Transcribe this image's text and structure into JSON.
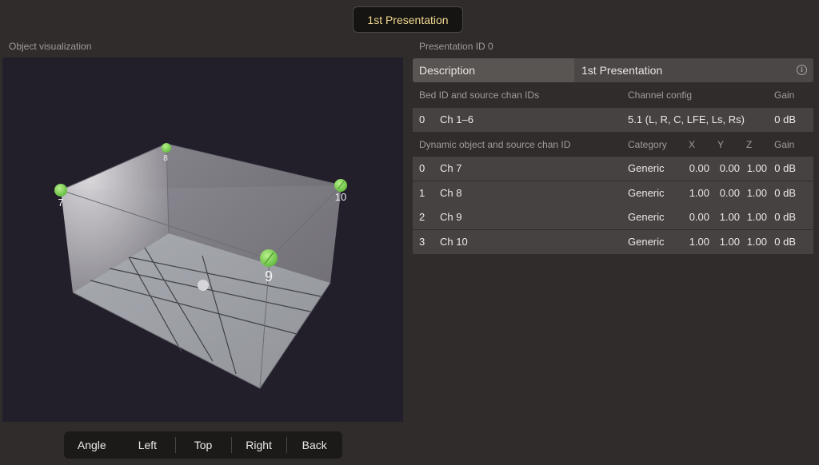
{
  "presentation_tab": "1st Presentation",
  "visualization": {
    "label": "Object visualization",
    "objects": [
      "7",
      "8",
      "9",
      "10"
    ]
  },
  "view_buttons": [
    "Angle",
    "Left",
    "Top",
    "Right",
    "Back"
  ],
  "panel": {
    "presentation_id_label": "Presentation ID 0",
    "description_label": "Description",
    "description_value": "1st Presentation",
    "bed_header": {
      "ids": "Bed ID and source chan IDs",
      "config": "Channel config",
      "gain": "Gain"
    },
    "bed_rows": [
      {
        "id": "0",
        "channels": "Ch 1–6",
        "config": "5.1 (L, R, C, LFE, Ls, Rs)",
        "gain": "0 dB"
      }
    ],
    "object_header": {
      "ids": "Dynamic object and source chan ID",
      "category": "Category",
      "x": "X",
      "y": "Y",
      "z": "Z",
      "gain": "Gain"
    },
    "object_rows": [
      {
        "id": "0",
        "channel": "Ch 7",
        "category": "Generic",
        "x": "0.00",
        "y": "0.00",
        "z": "1.00",
        "gain": "0 dB"
      },
      {
        "id": "1",
        "channel": "Ch 8",
        "category": "Generic",
        "x": "1.00",
        "y": "0.00",
        "z": "1.00",
        "gain": "0 dB"
      },
      {
        "id": "2",
        "channel": "Ch 9",
        "category": "Generic",
        "x": "0.00",
        "y": "1.00",
        "z": "1.00",
        "gain": "0 dB"
      },
      {
        "id": "3",
        "channel": "Ch 10",
        "category": "Generic",
        "x": "1.00",
        "y": "1.00",
        "z": "1.00",
        "gain": "0 dB"
      }
    ]
  },
  "colors": {
    "accent_text": "#f0d98e",
    "object_green": "#7fd65a"
  }
}
